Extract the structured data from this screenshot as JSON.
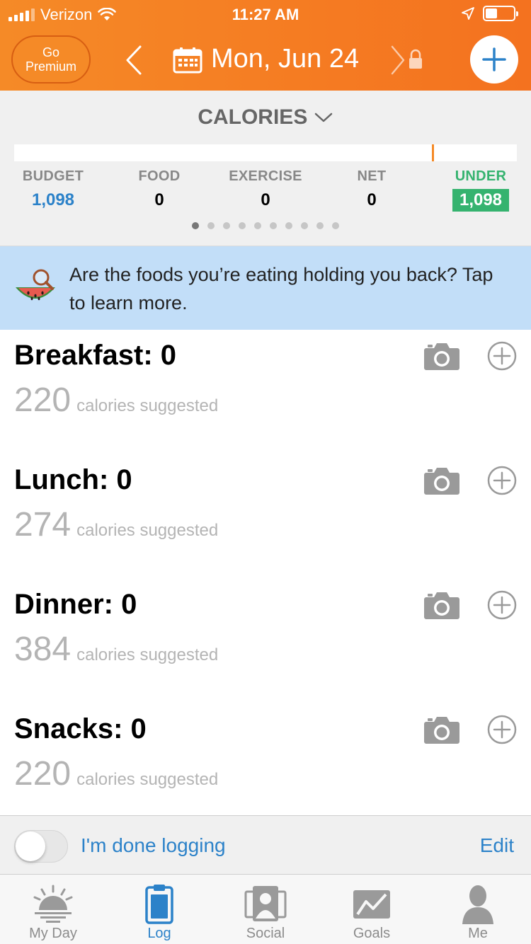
{
  "status_bar": {
    "carrier": "Verizon",
    "time": "11:27 AM"
  },
  "header": {
    "premium_line1": "Go",
    "premium_line2": "Premium",
    "date": "Mon, Jun 24"
  },
  "summary": {
    "title": "CALORIES",
    "stats": [
      {
        "label": "BUDGET",
        "value": "1,098"
      },
      {
        "label": "FOOD",
        "value": "0"
      },
      {
        "label": "EXERCISE",
        "value": "0"
      },
      {
        "label": "NET",
        "value": "0"
      },
      {
        "label": "UNDER",
        "value": "1,098"
      }
    ],
    "page_count": 10,
    "active_page": 0
  },
  "promo": {
    "text": "Are the foods you’re eating holding you back? Tap to learn more."
  },
  "meals": [
    {
      "title": "Breakfast: 0",
      "suggested": "220",
      "suggested_label": "calories suggested"
    },
    {
      "title": "Lunch: 0",
      "suggested": "274",
      "suggested_label": "calories suggested"
    },
    {
      "title": "Dinner: 0",
      "suggested": "384",
      "suggested_label": "calories suggested"
    },
    {
      "title": "Snacks: 0",
      "suggested": "220",
      "suggested_label": "calories suggested"
    }
  ],
  "done_bar": {
    "toggle_on": false,
    "label": "I'm done logging",
    "edit": "Edit"
  },
  "tabs": [
    {
      "label": "My Day",
      "icon": "sunrise-icon",
      "active": false
    },
    {
      "label": "Log",
      "icon": "clipboard-icon",
      "active": true
    },
    {
      "label": "Social",
      "icon": "people-icon",
      "active": false
    },
    {
      "label": "Goals",
      "icon": "envelope-chart-icon",
      "active": false
    },
    {
      "label": "Me",
      "icon": "person-icon",
      "active": false
    }
  ],
  "colors": {
    "brand_orange": "#f58a27",
    "accent_blue": "#2c82c9",
    "under_green": "#35b36f",
    "promo_blue": "#c2def8"
  }
}
